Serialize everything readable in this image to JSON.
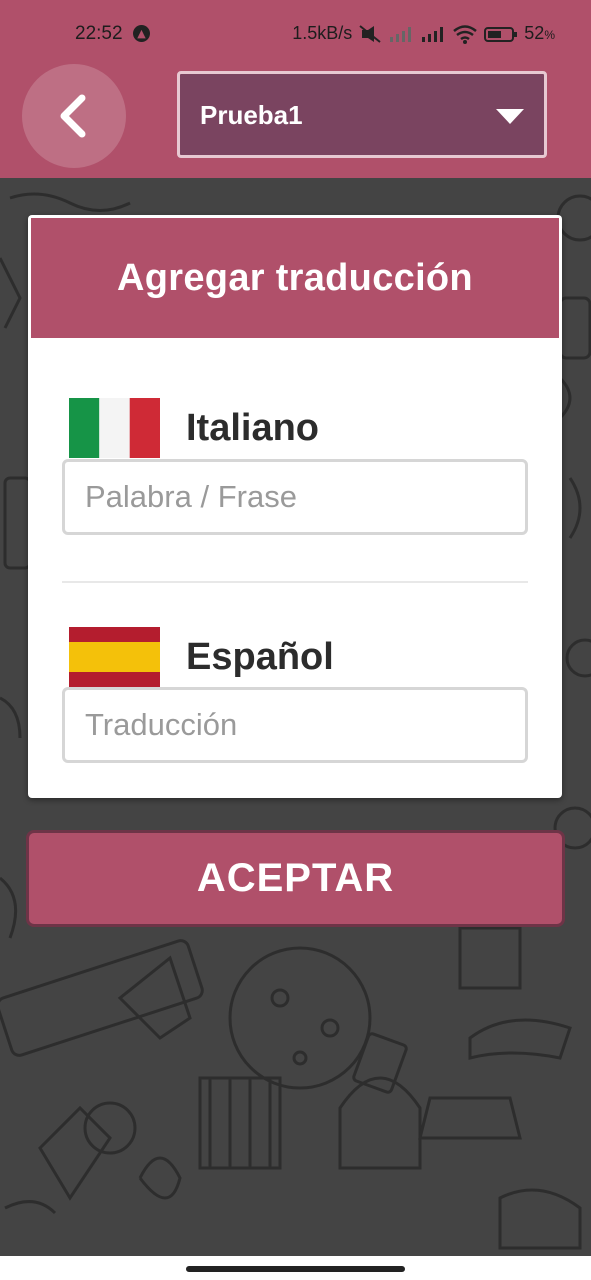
{
  "status_bar": {
    "time": "22:52",
    "network_speed": "1.5kB/s",
    "battery": "52",
    "battery_unit": "%"
  },
  "header": {
    "back_icon": "chevron-left-icon",
    "selected_list": "Prueba1",
    "dropdown_icon": "caret-down-icon"
  },
  "dialog": {
    "title": "Agregar traducción",
    "source": {
      "language": "Italiano",
      "flag": "italy-flag-icon",
      "placeholder": "Palabra / Frase",
      "value": ""
    },
    "target": {
      "language": "Español",
      "flag": "spain-flag-icon",
      "placeholder": "Traducción",
      "value": ""
    }
  },
  "actions": {
    "accept_label": "ACEPTAR"
  },
  "colors": {
    "primary": "#b0506a",
    "selector_bg": "#7a4460",
    "background": "#444444"
  }
}
